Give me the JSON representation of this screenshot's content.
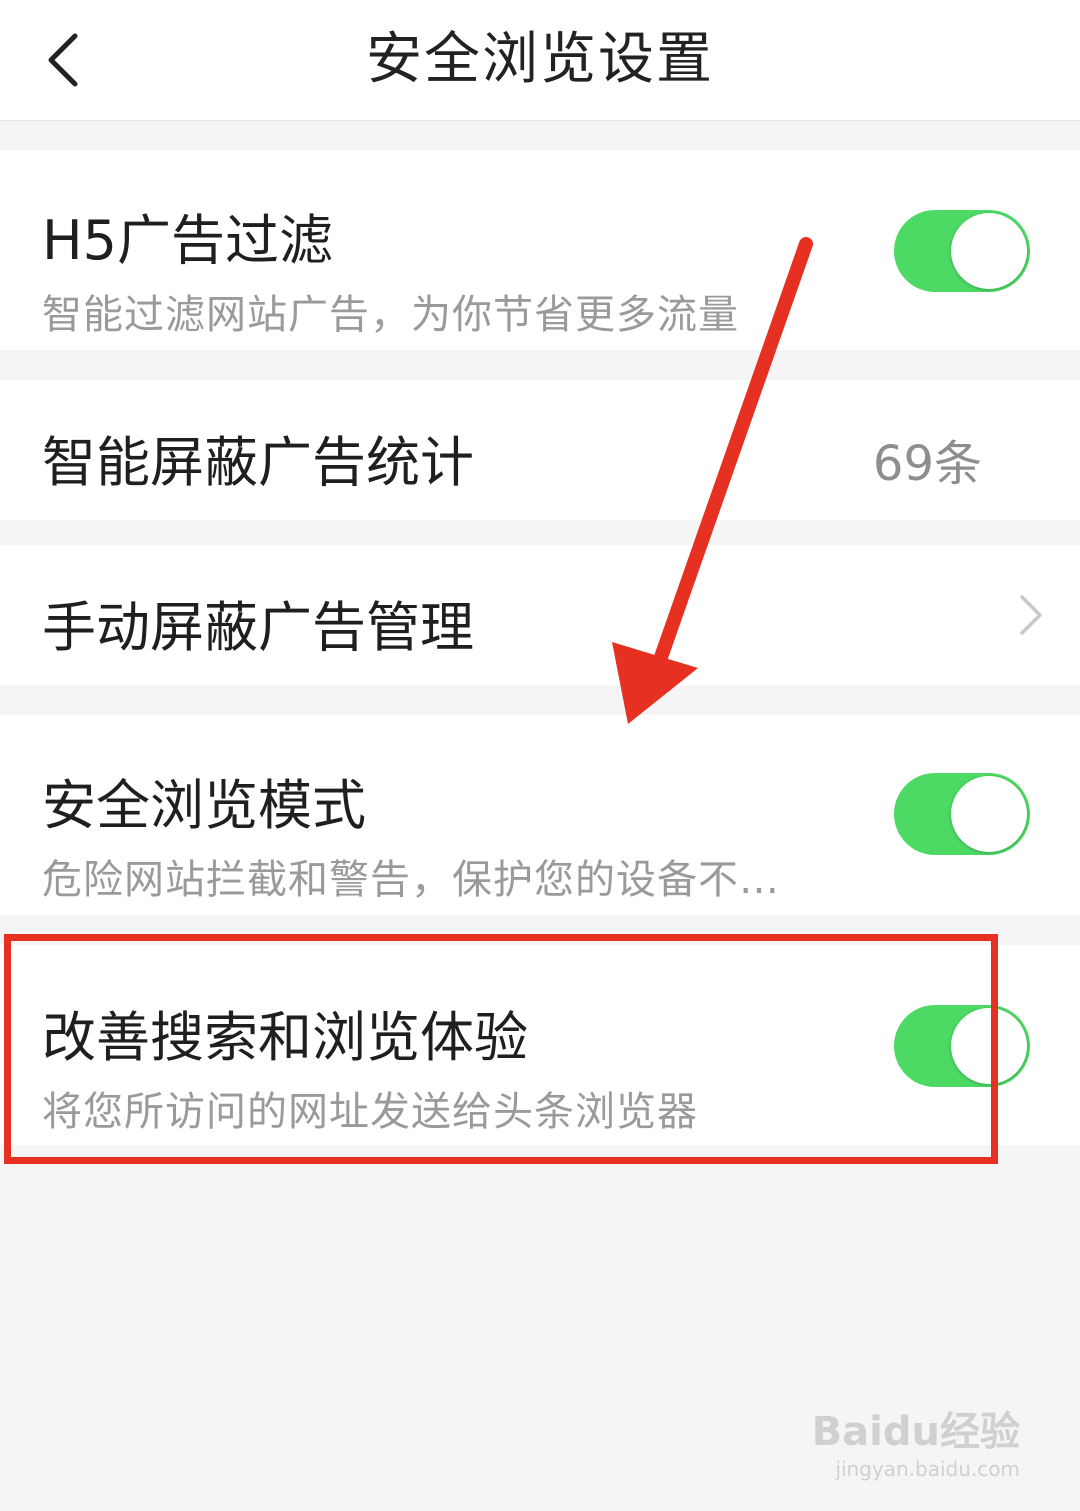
{
  "header": {
    "title": "安全浏览设置",
    "back_icon": "chevron-left-icon"
  },
  "settings": [
    {
      "label": "H5广告过滤",
      "desc": "智能过滤网站广告，为你节省更多流量",
      "toggle_on": true
    },
    {
      "label": "智能屏蔽广告统计",
      "value": "69条"
    },
    {
      "label": "手动屏蔽广告管理",
      "chevron_icon": "chevron-right-icon"
    },
    {
      "label": "安全浏览模式",
      "desc": "危险网站拦截和警告，保护您的设备不…",
      "toggle_on": true
    },
    {
      "label": "改善搜索和浏览体验",
      "desc": "将您所访问的网址发送给头条浏览器",
      "toggle_on": true
    }
  ],
  "colors": {
    "toggle_on": "#4cd964",
    "annotation_red": "#e63022",
    "page_bg": "#f5f5f5"
  },
  "watermark": {
    "brand": "Baidu经验",
    "url": "jingyan.baidu.com"
  }
}
